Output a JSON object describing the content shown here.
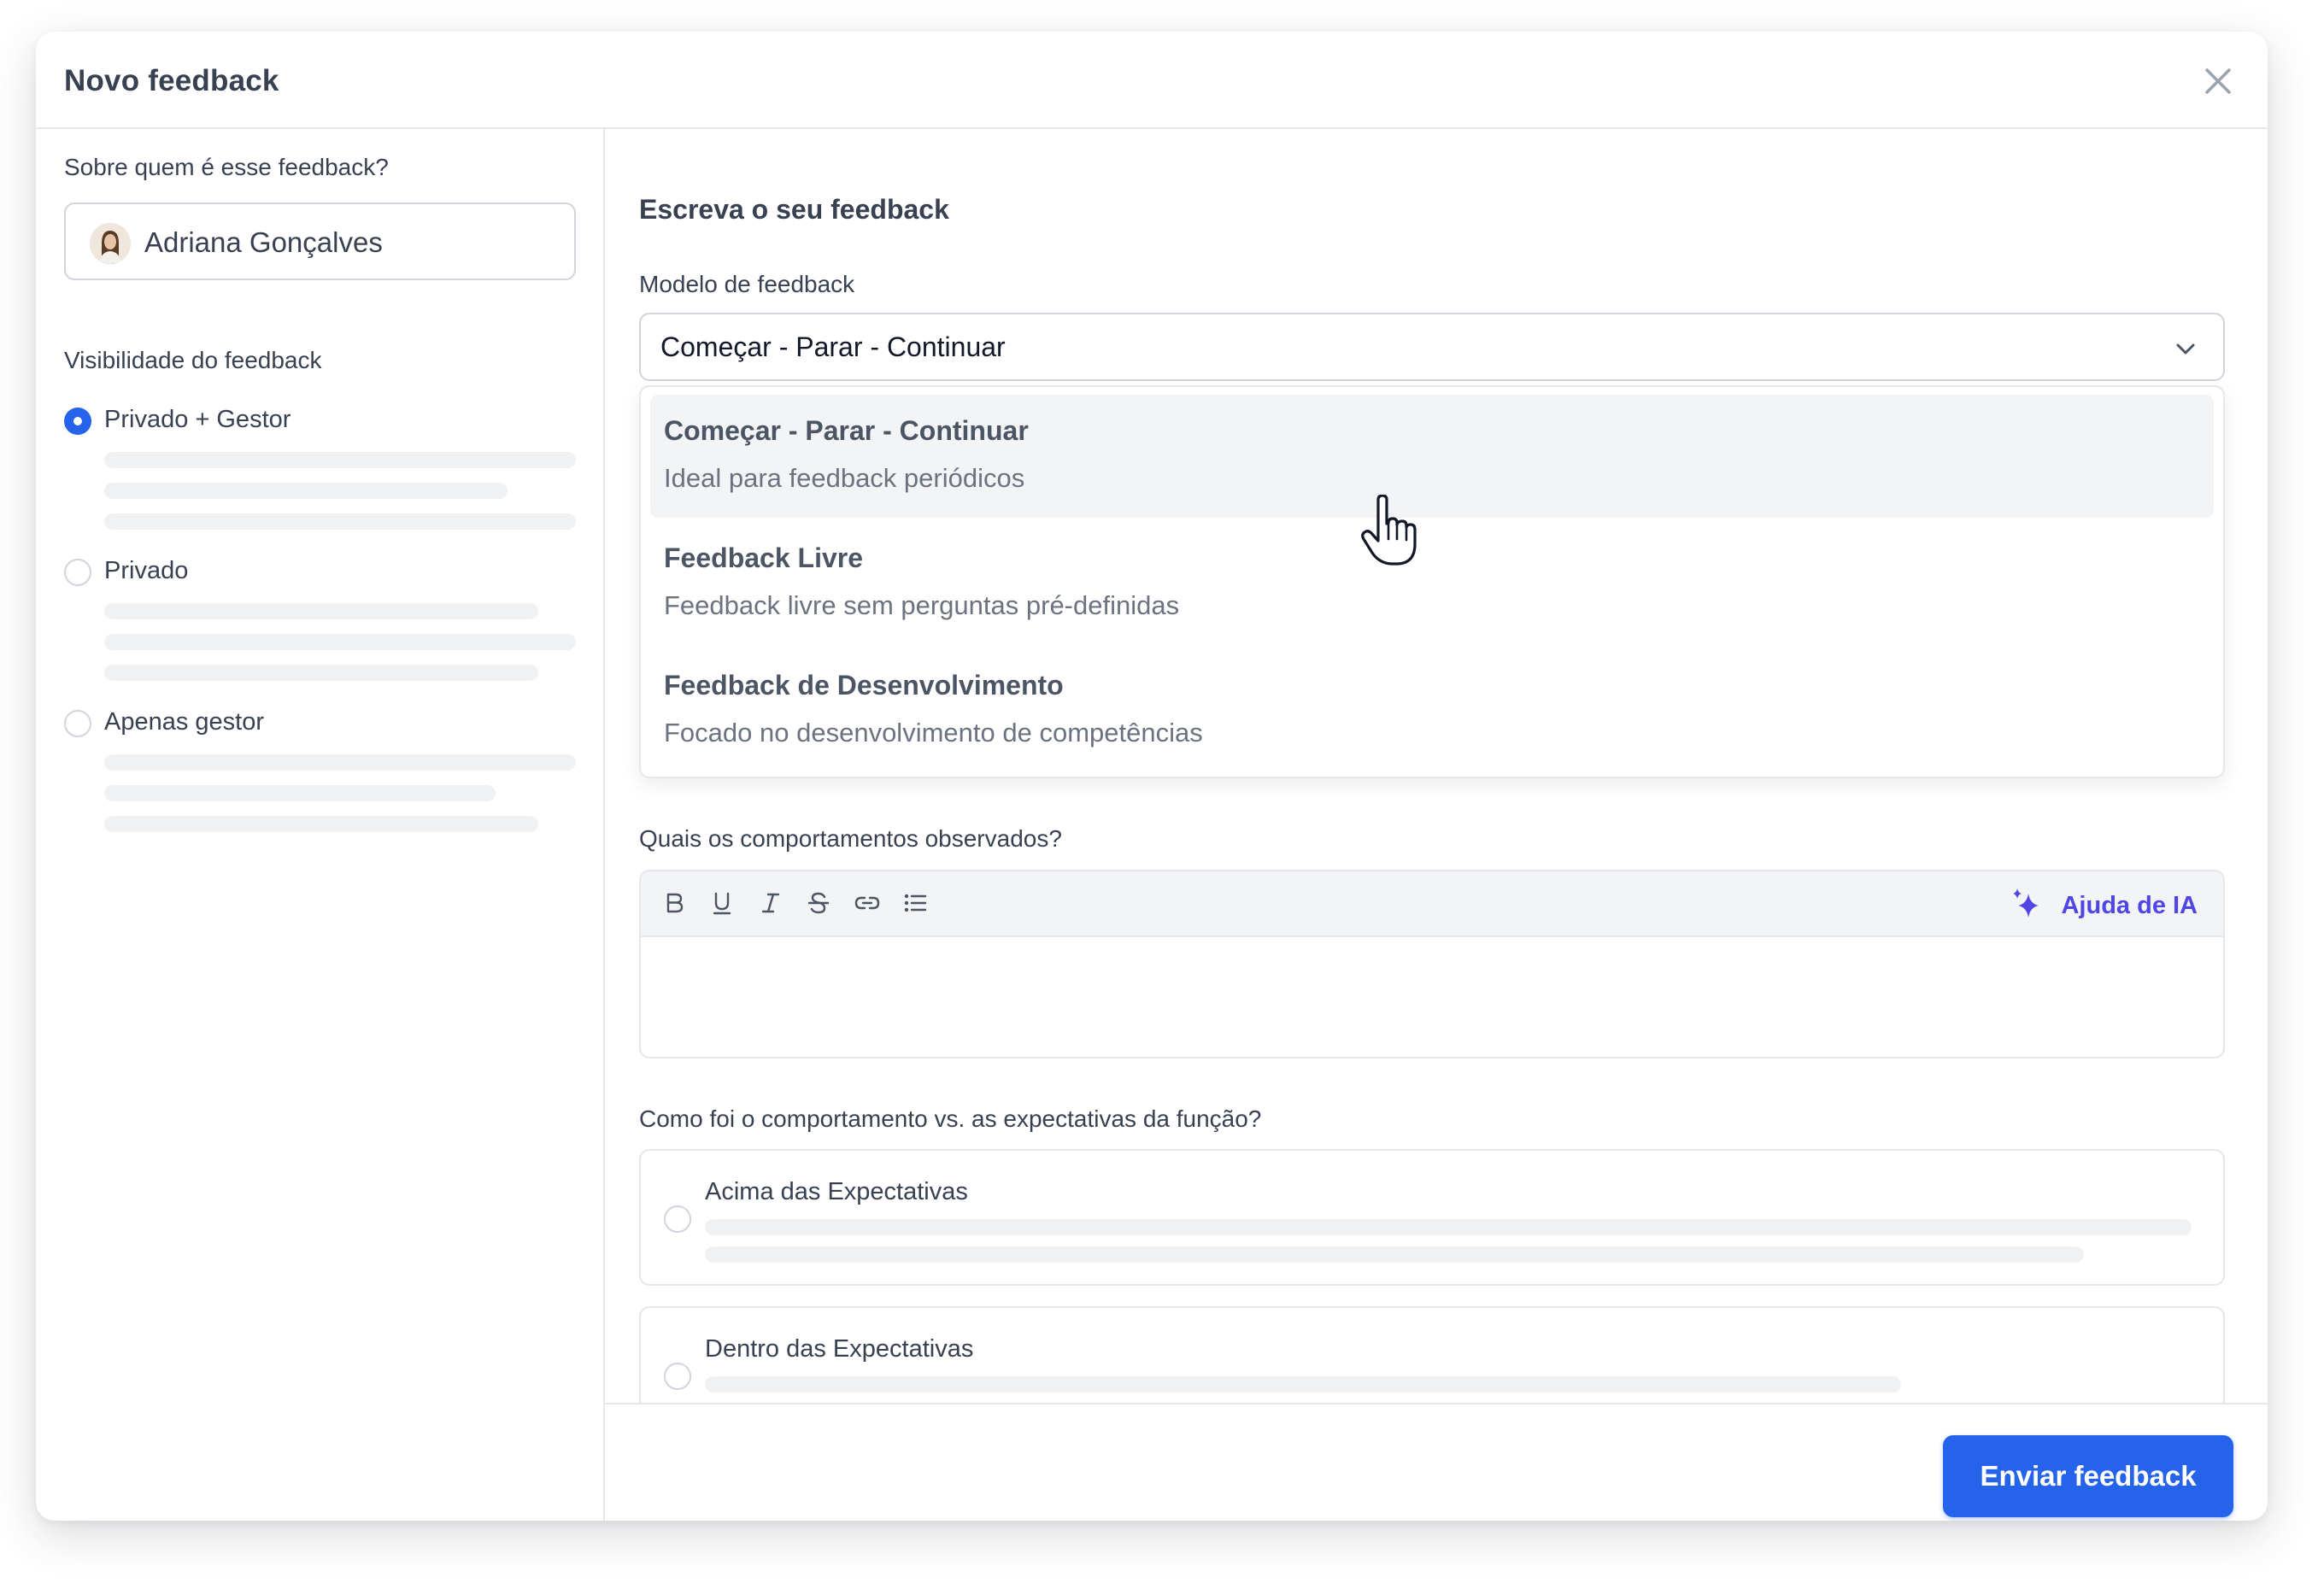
{
  "header": {
    "title": "Novo feedback",
    "close_icon": "close-icon"
  },
  "left": {
    "about_label": "Sobre quem é esse feedback?",
    "person_name": "Adriana Gonçalves",
    "visibility_label": "Visibilidade do feedback",
    "options": [
      {
        "label": "Privado + Gestor",
        "selected": true
      },
      {
        "label": "Privado",
        "selected": false
      },
      {
        "label": "Apenas gestor",
        "selected": false
      }
    ]
  },
  "right": {
    "section_title": "Escreva o seu feedback",
    "model_label": "Modelo de feedback",
    "model_value": "Começar - Parar - Continuar",
    "dropdown": [
      {
        "title": "Começar - Parar - Continuar",
        "desc": "Ideal para feedback periódicos",
        "highlighted": true
      },
      {
        "title": "Feedback Livre",
        "desc": "Feedback livre sem perguntas pré-definidas",
        "highlighted": false
      },
      {
        "title": "Feedback de Desenvolvimento",
        "desc": "Focado no desenvolvimento de competências",
        "highlighted": false
      }
    ],
    "behaviors_label": "Quais os comportamentos observados?",
    "toolbar": {
      "tools": [
        "bold-icon",
        "underline-icon",
        "italic-icon",
        "strikethrough-icon",
        "link-icon",
        "bullet-list-icon"
      ],
      "ai_label": "Ajuda de IA"
    },
    "expectations_label": "Como foi o comportamento vs. as expectativas da função?",
    "expectations": [
      {
        "label": "Acima das Expectativas"
      },
      {
        "label": "Dentro das Expectativas"
      }
    ]
  },
  "footer": {
    "submit_label": "Enviar feedback"
  },
  "colors": {
    "accent": "#2563eb",
    "ai": "#4f46e5",
    "border": "#e5e7eb",
    "skeleton": "#f0f1f3"
  }
}
